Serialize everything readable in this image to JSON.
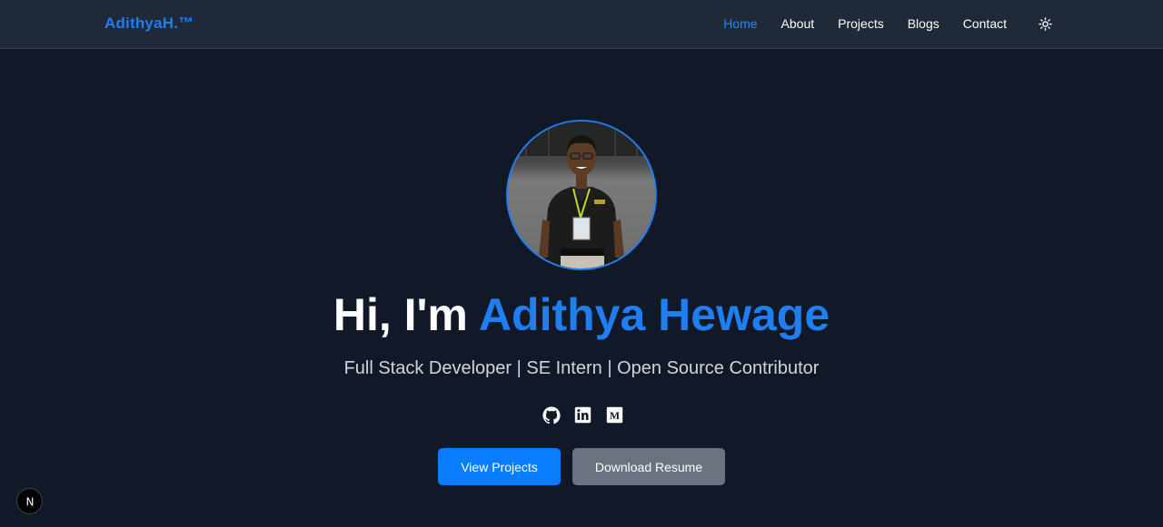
{
  "nav": {
    "brand": "AdithyaH.™",
    "links": [
      {
        "label": "Home",
        "active": true
      },
      {
        "label": "About",
        "active": false
      },
      {
        "label": "Projects",
        "active": false
      },
      {
        "label": "Blogs",
        "active": false
      },
      {
        "label": "Contact",
        "active": false
      }
    ],
    "theme_toggle_icon": "sun-icon"
  },
  "hero": {
    "avatar_icon": "profile-photo",
    "greeting": "Hi, I'm",
    "name": "Adithya Hewage",
    "subtitle": "Full Stack Developer | SE Intern | Open Source Contributor",
    "socials": [
      "github-icon",
      "linkedin-icon",
      "medium-icon"
    ],
    "primary_button": "View Projects",
    "secondary_button": "Download Resume"
  },
  "badge": {
    "label": "N"
  },
  "colors": {
    "background": "#111827",
    "navbar": "#1f2937",
    "accent": "#1f7ef0",
    "primary_button": "#0a7cff",
    "secondary_button": "#6b7280"
  }
}
